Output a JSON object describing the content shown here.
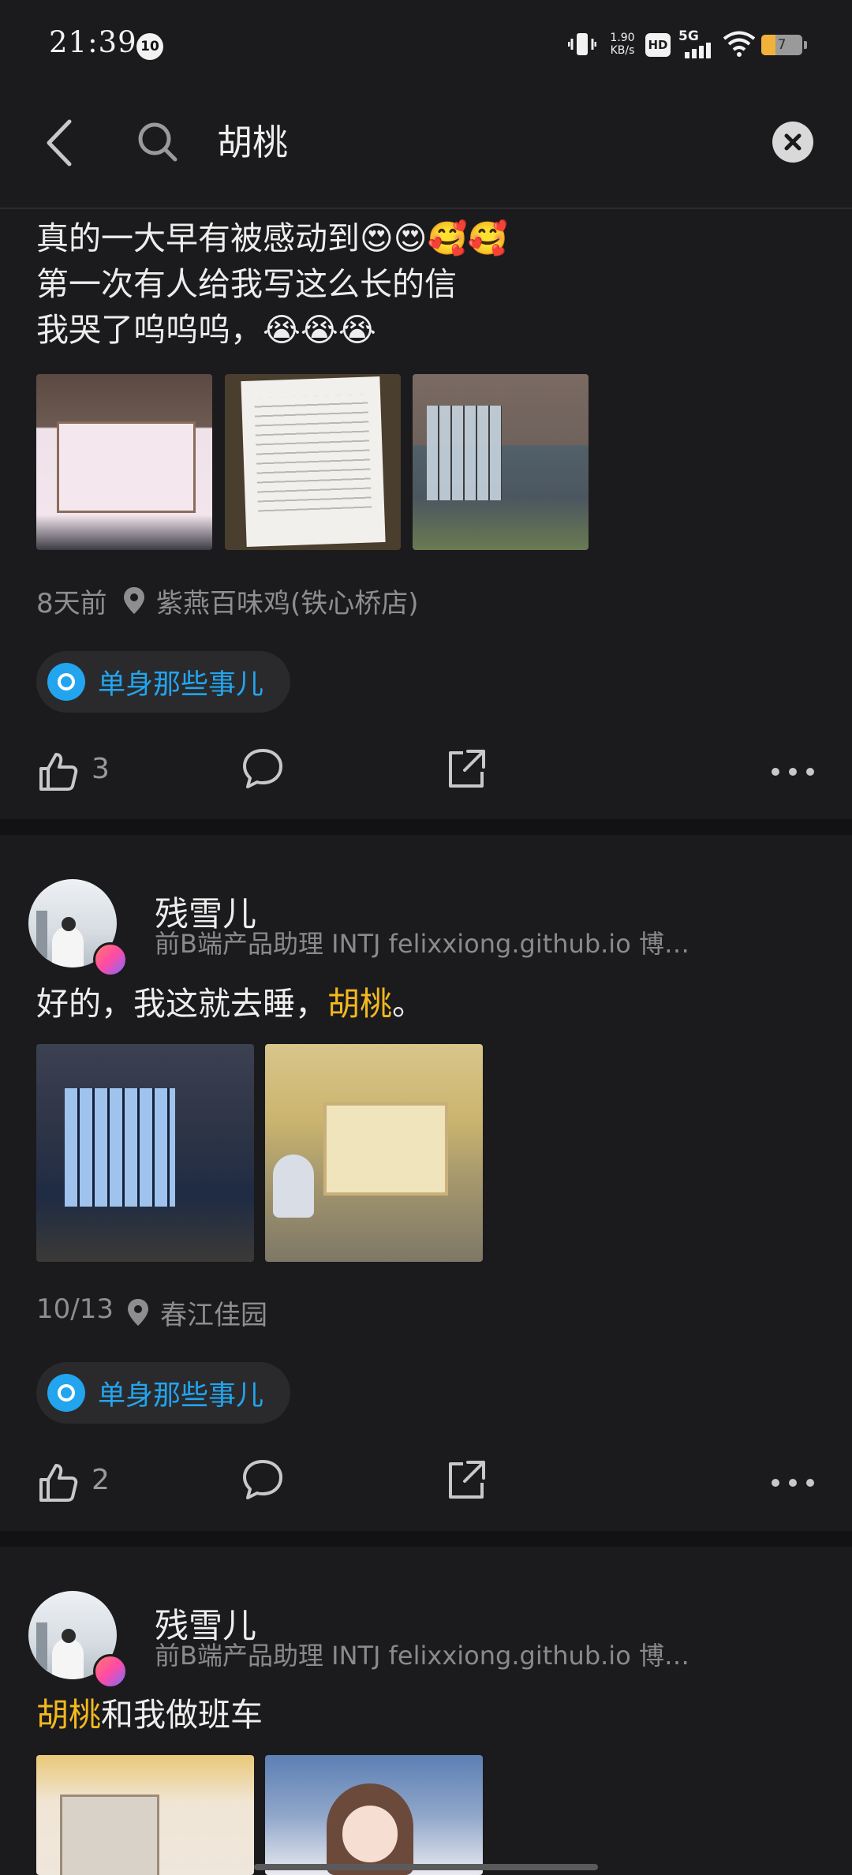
{
  "status_bar": {
    "time": "21:39",
    "notification_count": "10",
    "net_speed_top": "1.90",
    "net_speed_bottom": "KB/s",
    "hd_label": "HD",
    "network_label": "5G",
    "battery_level": "7"
  },
  "search": {
    "query": "胡桃"
  },
  "post1": {
    "text_lines": [
      "真的一大早有被感动到😍😍🥰🥰",
      "第一次有人给我写这么长的信",
      "我哭了呜呜呜，😭😭😭"
    ],
    "time": "8天前",
    "location": "紫燕百味鸡(铁心桥店)",
    "topic": "单身那些事儿",
    "like_count": "3"
  },
  "post2": {
    "author": "残雪儿",
    "bio": "前B端产品助理  INTJ    felixxiong.github.io  博…",
    "text_before": "好的，我这就去睡，",
    "text_highlight": "胡桃",
    "text_after": "。",
    "time": "10/13",
    "location": "春江佳园",
    "topic": "单身那些事儿",
    "like_count": "2"
  },
  "post3": {
    "author": "残雪儿",
    "bio": "前B端产品助理  INTJ    felixxiong.github.io  博…",
    "text_highlight": "胡桃",
    "text_after": "和我做班车"
  },
  "colors": {
    "background": "#1b1b1d",
    "highlight": "#f3b81f",
    "topic_accent": "#22a5ee",
    "secondary_text": "#8e8e90"
  }
}
